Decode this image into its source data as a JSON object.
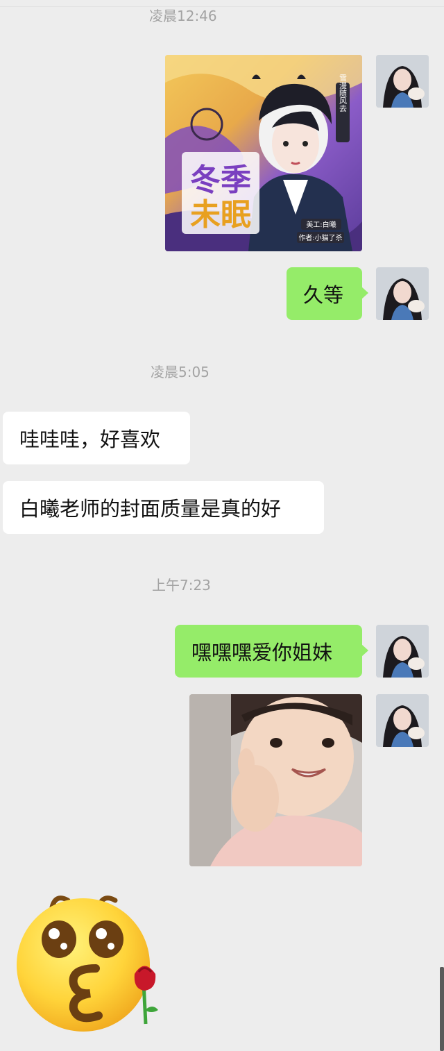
{
  "timestamps": [
    "凌晨12:46",
    "凌晨5:05",
    "上午7:23"
  ],
  "messages": {
    "sent_1": "久等",
    "recv_1": "哇哇哇，好喜欢",
    "recv_2": "白曦老师的封面质量是真的好",
    "sent_2": "嘿嘿嘿爱你姐妹"
  },
  "cover_image": {
    "title": "冬季未眠",
    "side_label": "雪漫随风去",
    "designer_credit": "美工:白曦",
    "author_credit": "作者:小猫了杀"
  },
  "colors": {
    "background": "#ededed",
    "sent_bubble": "#95ec69",
    "received_bubble": "#ffffff",
    "timestamp": "#a3a3a3"
  },
  "icons": {
    "sticker_emoji": "kissing-face-with-rose-emoji"
  }
}
